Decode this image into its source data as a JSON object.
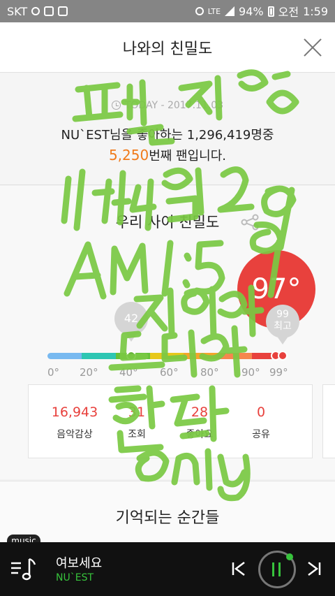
{
  "statusbar": {
    "carrier": "SKT",
    "battery": "94%",
    "period": "오전",
    "time": "1:59",
    "network": "LTE"
  },
  "header": {
    "title": "나와의 친밀도"
  },
  "today": {
    "label": "TODAY - 2017.11.03",
    "line1": "NU`EST님을 좋아하는 1,296,419명중",
    "rank": "5,250",
    "rank_suffix": "번째 팬입니다."
  },
  "intimacy": {
    "title": "우리 사이 친밀도",
    "score_badge": "97°",
    "current_bubble": "42",
    "max_bubble": "99",
    "max_label": "최고",
    "current_value": 42,
    "max_value": 99,
    "ticks": [
      "0°",
      "20°",
      "40°",
      "60°",
      "80°",
      "90°",
      "99°"
    ],
    "gauge_colors": [
      "#78b9f0",
      "#2ec6b3",
      "#66c238",
      "#e7c81b",
      "#f4a52b",
      "#f6864e",
      "#e8413d"
    ]
  },
  "stats": [
    {
      "value": "16,943",
      "label": "음악감상"
    },
    {
      "value": "31",
      "label": "조회"
    },
    {
      "value": "28",
      "label": "좋아요"
    },
    {
      "value": "0",
      "label": "공유"
    }
  ],
  "memories": {
    "title": "기억되는 순간들"
  },
  "player": {
    "tab": "music",
    "song": "여보세요",
    "artist": "NU`EST"
  },
  "handwriting": {
    "color": "#7ac943",
    "text": "팬된지 1114일 AM 1:59 자인아 드디어 한다 only"
  }
}
